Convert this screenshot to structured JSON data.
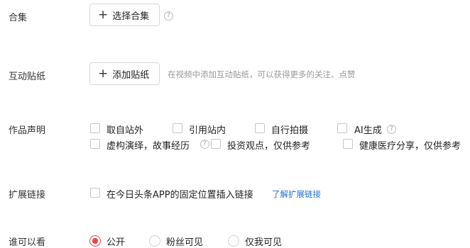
{
  "collection": {
    "label": "合集",
    "button_label": "选择合集",
    "help_icon": "help-icon"
  },
  "sticker": {
    "label": "互动贴纸",
    "button_label": "添加贴纸",
    "hint": "在视频中添加互动贴纸，可以获得更多的关注、点赞"
  },
  "declaration": {
    "label": "作品声明",
    "options": [
      "取自站外",
      "引用站内",
      "自行拍摄",
      "AI生成",
      "虚构演绎，故事经历",
      "投资观点，仅供参考",
      "健康医疗分享，仅供参考"
    ]
  },
  "extension": {
    "label": "扩展链接",
    "option": "在今日头条APP的固定位置插入链接",
    "link": "了解扩展链接"
  },
  "visibility": {
    "label": "谁可以看",
    "options": [
      "公开",
      "粉丝可见",
      "仅我可见"
    ],
    "selected": "公开",
    "accent_color": "#f04142"
  }
}
